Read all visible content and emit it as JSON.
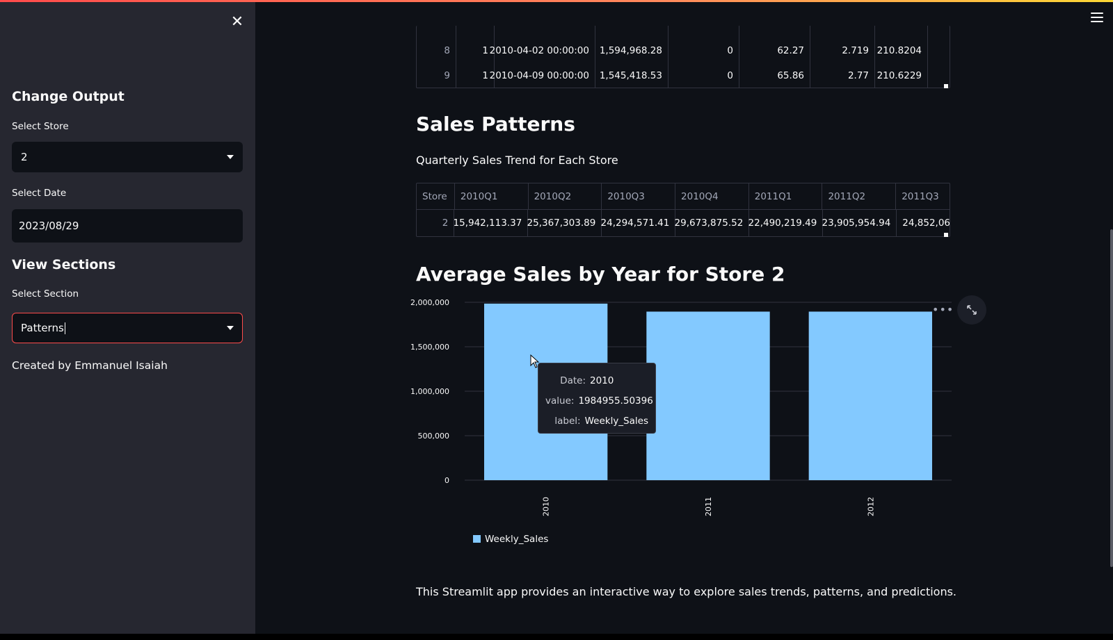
{
  "sidebar": {
    "change_output_heading": "Change Output",
    "store_label": "Select Store",
    "store_value": "2",
    "date_label": "Select Date",
    "date_value": "2023/08/29",
    "view_sections_heading": "View Sections",
    "section_label": "Select Section",
    "section_value": "Patterns",
    "footer": "Created by Emmanuel Isaiah"
  },
  "top_table": {
    "rows": [
      [
        "8",
        "1",
        "2010-04-02 00:00:00",
        "1,594,968.28",
        "0",
        "62.27",
        "2.719",
        "210.8204"
      ],
      [
        "9",
        "1",
        "2010-04-09 00:00:00",
        "1,545,418.53",
        "0",
        "65.86",
        "2.77",
        "210.6229"
      ]
    ]
  },
  "sales_patterns": {
    "heading": "Sales Patterns",
    "subtitle": "Quarterly Sales Trend for Each Store",
    "table": {
      "headers": [
        "Store",
        "2010Q1",
        "2010Q2",
        "2010Q3",
        "2010Q4",
        "2011Q1",
        "2011Q2",
        "2011Q3"
      ],
      "rows": [
        [
          "2",
          "15,942,113.37",
          "25,367,303.89",
          "24,294,571.41",
          "29,673,875.52",
          "22,490,219.49",
          "23,905,954.94",
          "24,852,06"
        ]
      ]
    }
  },
  "avg_sales": {
    "heading": "Average Sales by Year for Store 2",
    "more_label": "•••",
    "tooltip": {
      "date_key": "Date:",
      "date_val": "2010",
      "value_key": "value:",
      "value_val": "1984955.50396",
      "label_key": "label:",
      "label_val": "Weekly_Sales"
    }
  },
  "chart_data": {
    "type": "bar",
    "categories": [
      "2010",
      "2011",
      "2012"
    ],
    "series": [
      {
        "name": "Weekly_Sales",
        "values": [
          1984955.50396,
          1895000,
          1895000
        ]
      }
    ],
    "ylim": [
      0,
      2000000
    ],
    "yticks": [
      0,
      500000,
      1000000,
      1500000,
      2000000
    ],
    "ytick_labels": [
      "0",
      "500,000",
      "1,000,000",
      "1,500,000",
      "2,000,000"
    ],
    "legend": "bottom-left",
    "bar_color": "#83c9ff",
    "grid": true
  },
  "footer_text": "This Streamlit app provides an interactive way to explore sales trends, patterns, and predictions."
}
